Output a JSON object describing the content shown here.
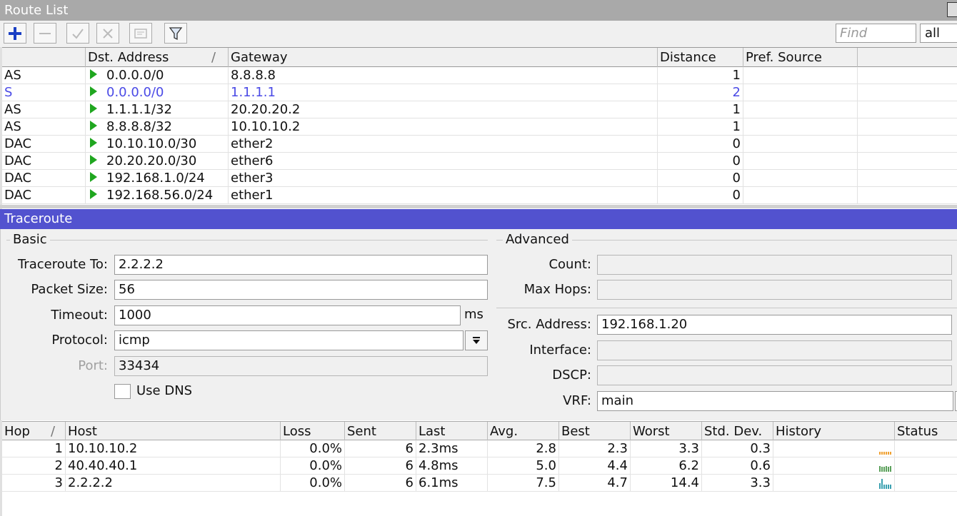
{
  "route_list": {
    "title": "Route List",
    "find_placeholder": "Find",
    "filter_value": "all",
    "columns": [
      "",
      "Dst. Address",
      "Gateway",
      "Distance",
      "Pref. Source"
    ],
    "sort_indicator": "/",
    "rows": [
      {
        "flags": "AS",
        "dst": "0.0.0.0/0",
        "gateway": "8.8.8.8",
        "distance": "1",
        "pref": "",
        "inactive": false
      },
      {
        "flags": "S",
        "dst": "0.0.0.0/0",
        "gateway": "1.1.1.1",
        "distance": "2",
        "pref": "",
        "inactive": true
      },
      {
        "flags": "AS",
        "dst": "1.1.1.1/32",
        "gateway": "20.20.20.2",
        "distance": "1",
        "pref": ""
      },
      {
        "flags": "AS",
        "dst": "8.8.8.8/32",
        "gateway": "10.10.10.2",
        "distance": "1",
        "pref": ""
      },
      {
        "flags": "DAC",
        "dst": "10.10.10.0/30",
        "gateway": "ether2",
        "distance": "0",
        "pref": ""
      },
      {
        "flags": "DAC",
        "dst": "20.20.20.0/30",
        "gateway": "ether6",
        "distance": "0",
        "pref": ""
      },
      {
        "flags": "DAC",
        "dst": "192.168.1.0/24",
        "gateway": "ether3",
        "distance": "0",
        "pref": ""
      },
      {
        "flags": "DAC",
        "dst": "192.168.56.0/24",
        "gateway": "ether1",
        "distance": "0",
        "pref": ""
      }
    ],
    "colors": {
      "title_bar": "#a9a9a9",
      "inactive_text": "#4a4ae6",
      "route_arrow": "#1fa61f",
      "add_icon": "#1a3fc4"
    }
  },
  "traceroute": {
    "title": "Traceroute",
    "title_color": "#5252cf",
    "basic": {
      "group_label": "Basic",
      "traceroute_to_label": "Traceroute To:",
      "traceroute_to": "2.2.2.2",
      "packet_size_label": "Packet Size:",
      "packet_size": "56",
      "timeout_label": "Timeout:",
      "timeout": "1000",
      "timeout_unit": "ms",
      "protocol_label": "Protocol:",
      "protocol": "icmp",
      "port_label": "Port:",
      "port": "33434",
      "use_dns_label": "Use DNS"
    },
    "advanced": {
      "group_label": "Advanced",
      "count_label": "Count:",
      "count": "",
      "max_hops_label": "Max Hops:",
      "max_hops": "",
      "src_address_label": "Src. Address:",
      "src_address": "192.168.1.20",
      "interface_label": "Interface:",
      "interface": "",
      "dscp_label": "DSCP:",
      "dscp": "",
      "vrf_label": "VRF:",
      "vrf": "main"
    },
    "hops_table": {
      "columns": [
        "Hop",
        "Host",
        "Loss",
        "Sent",
        "Last",
        "Avg.",
        "Best",
        "Worst",
        "Std. Dev.",
        "History",
        "Status"
      ],
      "sort_indicator": "/",
      "rows": [
        {
          "hop": "1",
          "host": "10.10.10.2",
          "loss": "0.0%",
          "sent": "6",
          "last": "2.3ms",
          "avg": "2.8",
          "best": "2.3",
          "worst": "3.3",
          "stddev": "0.3",
          "status": "",
          "history_color": "#f0a030",
          "history": [
            0.3,
            0.3,
            0.3,
            0.3,
            0.3,
            0.3
          ]
        },
        {
          "hop": "2",
          "host": "40.40.40.1",
          "loss": "0.0%",
          "sent": "6",
          "last": "4.8ms",
          "avg": "5.0",
          "best": "4.4",
          "worst": "6.2",
          "stddev": "0.6",
          "status": "",
          "history_color": "#5aa05a",
          "history": [
            0.6,
            0.5,
            0.5,
            0.55,
            0.5,
            0.6
          ]
        },
        {
          "hop": "3",
          "host": "2.2.2.2",
          "loss": "0.0%",
          "sent": "6",
          "last": "6.1ms",
          "avg": "7.5",
          "best": "4.7",
          "worst": "14.4",
          "stddev": "3.3",
          "status": "",
          "history_color": "#3aa0b0",
          "history": [
            0.55,
            1.0,
            0.4,
            0.45,
            0.45,
            0.45
          ]
        }
      ]
    }
  }
}
